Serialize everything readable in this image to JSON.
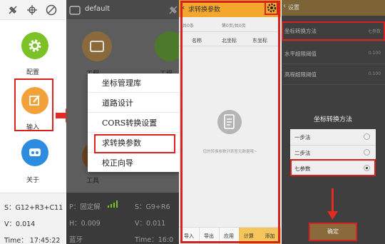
{
  "panel1": {
    "apps": [
      {
        "label": "配置",
        "icon": "gear-icon",
        "color": "#7cc227"
      },
      {
        "label": "输入",
        "icon": "edit-icon",
        "color": "#f3a13a"
      },
      {
        "label": "关于",
        "icon": "info-icon",
        "color": "#2e8ce0"
      }
    ],
    "status": {
      "line1": "S：G12+R3+C11",
      "line2": "V：0.014",
      "line3": "Time：  17:45:22"
    }
  },
  "panel2": {
    "title": "default",
    "bg_labels": {
      "left1": "工程",
      "left2": "工具",
      "right1": "工程"
    },
    "menu": [
      "坐标管理库",
      "道路设计",
      "CORS转换设置",
      "求转换参数",
      "校正向导"
    ],
    "status": {
      "l1": "P：固定解",
      "l2": "H：0.009",
      "l3": "蓝牙",
      "r1": "S：G9+R6",
      "r2": "V：0.011",
      "r3": "Time：16:0"
    }
  },
  "panel3": {
    "title": "求转换参数",
    "count_left": "共0条",
    "count_right": "第0页/共0页",
    "columns": [
      "名称",
      "北坐标",
      "东坐标"
    ],
    "empty_text": "您的转换参数列表暂无数据哦~",
    "buttons": [
      "导入",
      "导出",
      "应用",
      "计算",
      "添加"
    ]
  },
  "panel4": {
    "title": "设置",
    "rows": [
      {
        "label": "坐标转换方法",
        "value": "七参数"
      },
      {
        "label": "水平超限阈值",
        "value": "0.100"
      },
      {
        "label": "高程超限阈值",
        "value": "0.100"
      }
    ],
    "dialog": {
      "title": "坐标转换方法",
      "options": [
        {
          "label": "一步法",
          "selected": false
        },
        {
          "label": "二步法",
          "selected": false
        },
        {
          "label": "七参数",
          "selected": true
        }
      ]
    },
    "confirm": "确定"
  },
  "colors": {
    "highlight": "#d9211f",
    "accent_orange": "#f3a82d"
  }
}
